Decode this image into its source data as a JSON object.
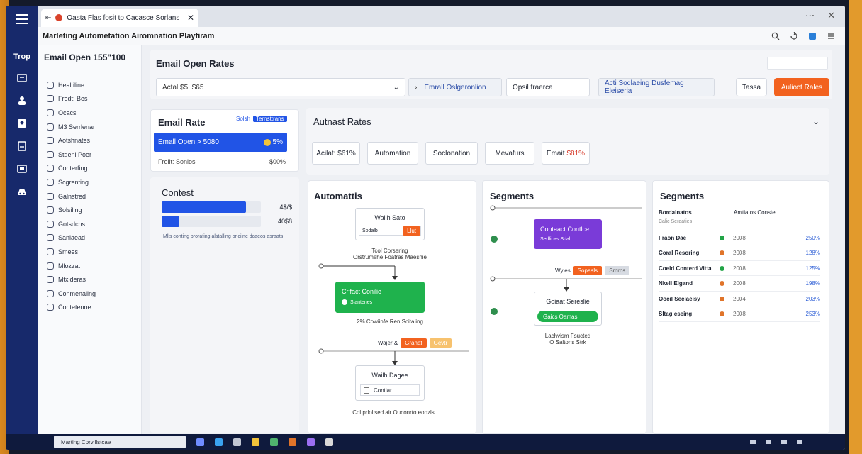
{
  "tab": {
    "title": "Oasta Flas fosit to Cacasce Sorlans"
  },
  "app": {
    "title": "Marleting Autometation Airomnation Playfiram"
  },
  "rail": {
    "label": "Trop"
  },
  "sidebar": {
    "heading": "Email Open 155\"100",
    "items": [
      "Healtiline",
      "Fredt: Bes",
      "Ocacs",
      "M3 Serrlenar",
      "Aotshnates",
      "Stdenl Poer",
      "Conterfing",
      "Scgrenting",
      "Galnstred",
      "Solsiling",
      "Gotsdcns",
      "Saniaead",
      "Smees",
      "Mlozzat",
      "Mtxlderas",
      "Conmenaling",
      "Contetenne"
    ]
  },
  "header": {
    "title": "Email Open Rates",
    "filter1": "Actal $5, $65",
    "filter2": "Emrall Oslgeronlion",
    "filter3": "Opsil fraerca",
    "filter4": "Acti Soclaeing  Dusfemag Eleiseria",
    "btn_secondary": "Tassa",
    "btn_primary": "Aulioct Rales"
  },
  "email_rate": {
    "title": "Email Rate",
    "badge_left": "Solsh",
    "badge_right": "Ternsttrans",
    "bar_label": "Emall Open > 5080",
    "bar_value": "5%",
    "row_label": "Frollt: Sonlos",
    "row_value": "$00%"
  },
  "contest": {
    "title": "Contest",
    "bars": [
      {
        "value_label": "4$/$",
        "fraction": 0.85
      },
      {
        "value_label": "40$8",
        "fraction": 0.18
      }
    ],
    "footnote": "Mlls conting prorafing alstalling oncilne dcaeos asraats"
  },
  "automation_rates": {
    "title": "Autnast Rates",
    "chips": [
      {
        "label": "Acilat: $61%"
      },
      {
        "label": "Automation"
      },
      {
        "label": "Soclonation"
      },
      {
        "label": "Mevafurs"
      },
      {
        "label": "Emait",
        "accent": "$81%"
      }
    ]
  },
  "automation": {
    "title": "Automattis",
    "node1_title": "Wailh Sato",
    "node1_field": "Sodalb",
    "node1_tag": "Llut",
    "caption1a": "Tcol Corsering",
    "caption1b": "Orstrumehe Foatras Maesnie",
    "node2_title": "Crifact Conilie",
    "node2_sub": "Siantenes",
    "caption2": "2% Cowiinfe Ren Scitaling",
    "wait_label": "Wajer &",
    "wait_tag1": "Granat",
    "wait_tag2": "Gevtr",
    "node3_title": "Wailh Dagee",
    "node3_field": "Contiar",
    "caption3": "Cdl prlollsed air Ouconrto eonzls"
  },
  "segments_flow": {
    "title": "Segments",
    "node1_title": "Contaact Contlce",
    "node1_sub": "Sedlicas Sdal",
    "wait_label": "Wyles",
    "wait_tag1": "Sopasls",
    "wait_tag2": "Smrns",
    "node2_title": "Goiaat Sereslie",
    "node2_btn": "Gaics Oamas",
    "caption_a": "Lachvism Fsucted",
    "caption_b": "O Saltons Strk"
  },
  "segments_table": {
    "title": "Segments",
    "header_a": "Bordalnatos",
    "header_b": "Amtiatos Conste",
    "subheader": "Calic Seraaties",
    "rows": [
      {
        "name": "Fraon Dae",
        "color": "#22a447",
        "year": "2008",
        "pct": "250%"
      },
      {
        "name": "Coral Resoring",
        "color": "#e0742a",
        "year": "2008",
        "pct": "128%"
      },
      {
        "name": "Coeld Conterd Vitta",
        "color": "#22a447",
        "year": "2008",
        "pct": "125%"
      },
      {
        "name": "Nkell Eigand",
        "color": "#e0742a",
        "year": "2008",
        "pct": "198%"
      },
      {
        "name": "Oocil Seclaeisy",
        "color": "#e0742a",
        "year": "2004",
        "pct": "203%"
      },
      {
        "name": "Sltag cseing",
        "color": "#e0742a",
        "year": "2008",
        "pct": "253%"
      }
    ]
  },
  "taskbar": {
    "app_label": "Marting Corvillstcae"
  },
  "colors": {
    "primary_blue": "#2154e6",
    "orange": "#f2621f",
    "green": "#1fb24d",
    "purple": "#7a3bd8",
    "rail": "#17296b"
  }
}
